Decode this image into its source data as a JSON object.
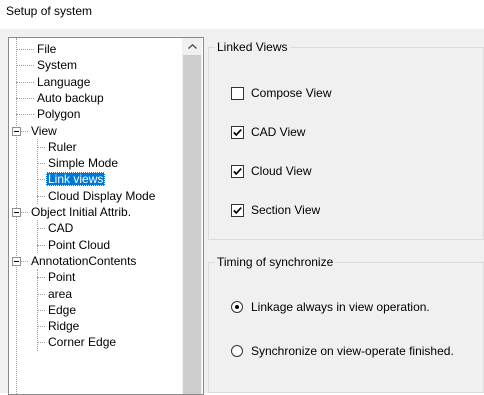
{
  "window": {
    "title": "Setup of system"
  },
  "tree": {
    "items": [
      {
        "label": "File",
        "level": 1,
        "expanded": null,
        "selected": false
      },
      {
        "label": "System",
        "level": 1,
        "expanded": null,
        "selected": false
      },
      {
        "label": "Language",
        "level": 1,
        "expanded": null,
        "selected": false
      },
      {
        "label": "Auto backup",
        "level": 1,
        "expanded": null,
        "selected": false
      },
      {
        "label": "Polygon",
        "level": 1,
        "expanded": null,
        "selected": false
      },
      {
        "label": "View",
        "level": 0,
        "expanded": true,
        "selected": false
      },
      {
        "label": "Ruler",
        "level": 2,
        "expanded": null,
        "selected": false
      },
      {
        "label": "Simple Mode",
        "level": 2,
        "expanded": null,
        "selected": false
      },
      {
        "label": "Link views",
        "level": 2,
        "expanded": null,
        "selected": true
      },
      {
        "label": "Cloud Display Mode",
        "level": 2,
        "expanded": null,
        "selected": false
      },
      {
        "label": "Object Initial Attrib.",
        "level": 0,
        "expanded": true,
        "selected": false
      },
      {
        "label": "CAD",
        "level": 2,
        "expanded": null,
        "selected": false
      },
      {
        "label": "Point Cloud",
        "level": 2,
        "expanded": null,
        "selected": false
      },
      {
        "label": "AnnotationContents",
        "level": 0,
        "expanded": true,
        "selected": false
      },
      {
        "label": "Point",
        "level": 2,
        "expanded": null,
        "selected": false
      },
      {
        "label": "area",
        "level": 2,
        "expanded": null,
        "selected": false
      },
      {
        "label": "Edge",
        "level": 2,
        "expanded": null,
        "selected": false
      },
      {
        "label": "Ridge",
        "level": 2,
        "expanded": null,
        "selected": false
      },
      {
        "label": "Corner Edge",
        "level": 2,
        "expanded": null,
        "selected": false
      }
    ]
  },
  "linked_views": {
    "title": "Linked Views",
    "options": [
      {
        "label": "Compose View",
        "checked": false
      },
      {
        "label": "CAD View",
        "checked": true
      },
      {
        "label": "Cloud View",
        "checked": true
      },
      {
        "label": "Section View",
        "checked": true
      }
    ]
  },
  "timing": {
    "title": "Timing of synchronize",
    "options": [
      {
        "label": "Linkage always in view operation.",
        "selected": true
      },
      {
        "label": "Synchronize on view-operate finished.",
        "selected": false
      }
    ]
  }
}
